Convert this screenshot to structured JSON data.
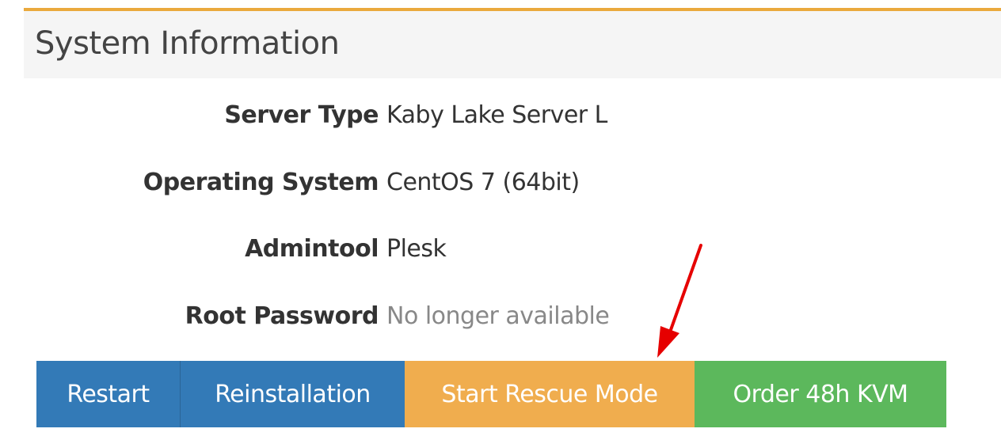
{
  "panel": {
    "title": "System Information"
  },
  "info": [
    {
      "label": "Server Type",
      "value": "Kaby Lake Server L"
    },
    {
      "label": "Operating System",
      "value": "CentOS 7 (64bit)"
    },
    {
      "label": "Admintool",
      "value": "Plesk"
    },
    {
      "label": "Root Password",
      "value": "No longer available"
    }
  ],
  "actions": {
    "restart": "Restart",
    "reinstallation": "Reinstallation",
    "rescue": "Start Rescue Mode",
    "kvm": "Order 48h KVM"
  },
  "colors": {
    "accent": "#eaa93d",
    "primary": "#337ab7",
    "warning": "#f0ad4e",
    "success": "#5cb85c",
    "annotation_arrow": "#e60000"
  }
}
